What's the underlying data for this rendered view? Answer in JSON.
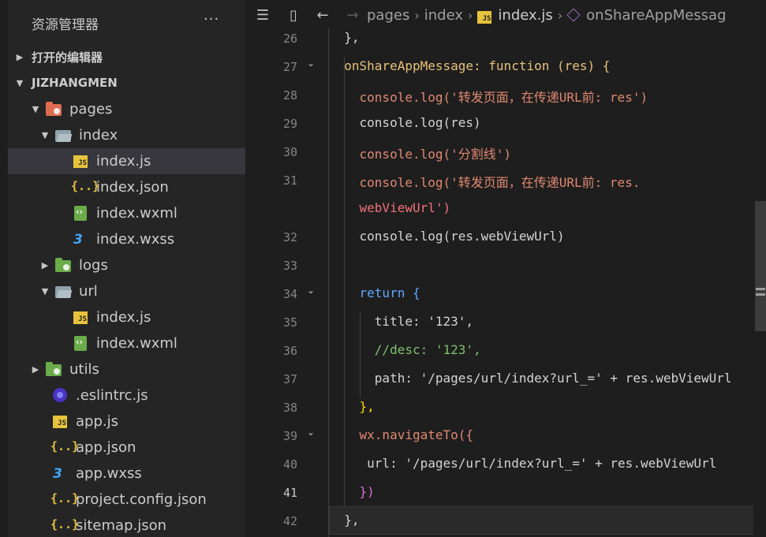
{
  "sidebar": {
    "title": "资源管理器",
    "more": "···",
    "open_editors": "打开的编辑器",
    "project": "JIZHANGMEN",
    "tree": [
      {
        "label": "pages",
        "icon": "folder-pages-open-icon",
        "twisty": "▼"
      },
      {
        "label": "index",
        "icon": "folder-open-icon",
        "twisty": "▼"
      },
      {
        "label": "index.js",
        "icon": "js-file-icon"
      },
      {
        "label": "index.json",
        "icon": "json-file-icon"
      },
      {
        "label": "index.wxml",
        "icon": "wxml-file-icon"
      },
      {
        "label": "index.wxss",
        "icon": "css-file-icon"
      },
      {
        "label": "logs",
        "icon": "folder-logs-icon",
        "twisty": "▶"
      },
      {
        "label": "url",
        "icon": "folder-open-icon",
        "twisty": "▼"
      },
      {
        "label": "index.js",
        "icon": "js-file-icon"
      },
      {
        "label": "index.wxml",
        "icon": "wxml-file-icon"
      },
      {
        "label": "utils",
        "icon": "folder-utils-icon",
        "twisty": "▶"
      },
      {
        "label": ".eslintrc.js",
        "icon": "eslint-icon"
      },
      {
        "label": "app.js",
        "icon": "js-file-icon"
      },
      {
        "label": "app.json",
        "icon": "json-file-icon"
      },
      {
        "label": "app.wxss",
        "icon": "css-file-icon"
      },
      {
        "label": "project.config.json",
        "icon": "json-file-icon"
      },
      {
        "label": "sitemap.json",
        "icon": "json-file-icon"
      }
    ]
  },
  "editor": {
    "breadcrumb": [
      "pages",
      "index",
      "index.js",
      "onShareAppMessag"
    ],
    "js_badge": "JS",
    "lines": [
      {
        "num": "26",
        "text": "  },"
      },
      {
        "num": "27",
        "text": "  onShareAppMessage: function (res) {"
      },
      {
        "num": "28",
        "text": "    console.log('转发页面，在传递URL前: res')"
      },
      {
        "num": "29",
        "text": "    console.log(res)"
      },
      {
        "num": "30",
        "text": "    console.log('分割线')"
      },
      {
        "num": "31",
        "text": "    console.log('转发页面，在传递URL前: res."
      },
      {
        "num": "",
        "text": "    webViewUrl')"
      },
      {
        "num": "32",
        "text": "    console.log(res.webViewUrl)"
      },
      {
        "num": "33",
        "text": ""
      },
      {
        "num": "34",
        "text": "    return {"
      },
      {
        "num": "35",
        "text": "      title: '123',"
      },
      {
        "num": "36",
        "text": "      //desc: '123',"
      },
      {
        "num": "37",
        "text": "      path: '/pages/url/index?url_=' + res.webViewUrl"
      },
      {
        "num": "38",
        "text": "    },"
      },
      {
        "num": "39",
        "text": "    wx.navigateTo({"
      },
      {
        "num": "40",
        "text": "     url: '/pages/url/index?url_=' + res.webViewUrl"
      },
      {
        "num": "41",
        "text": "    })"
      },
      {
        "num": "42",
        "text": "  },"
      }
    ]
  }
}
